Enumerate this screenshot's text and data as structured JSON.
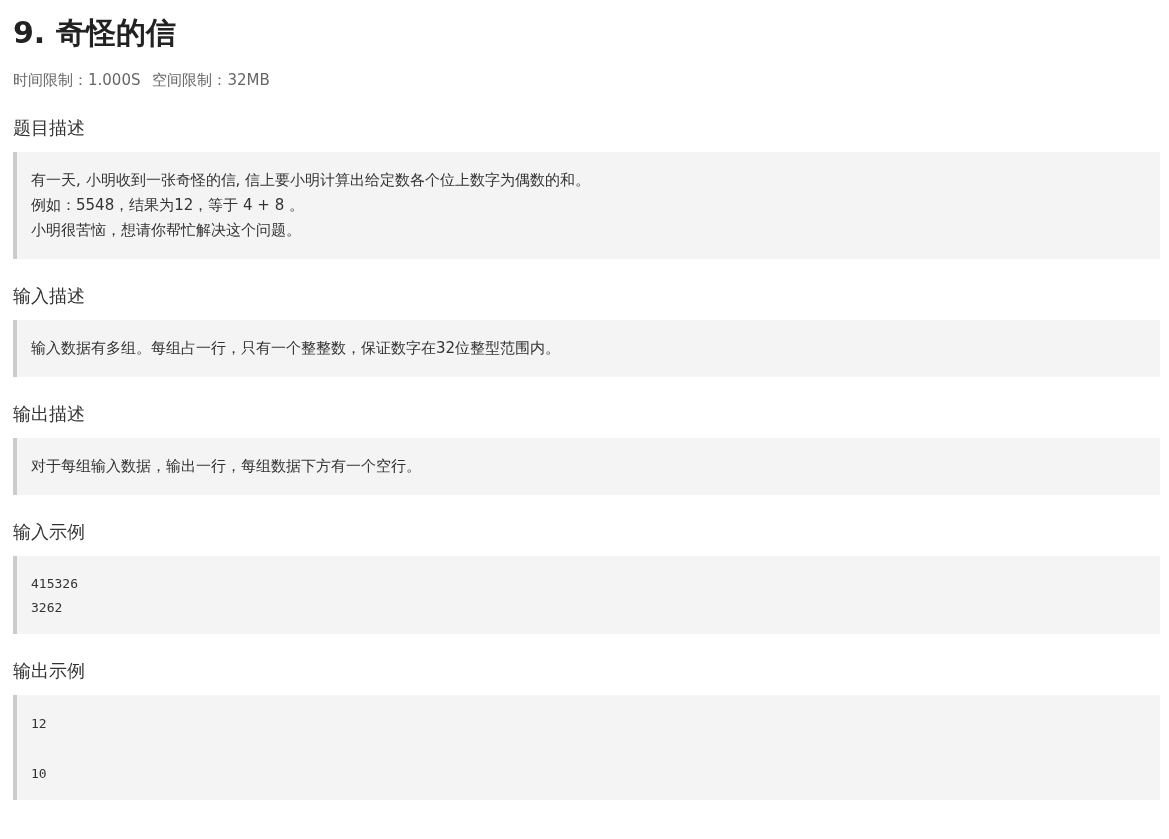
{
  "title": "9. 奇怪的信",
  "limits": [
    "时间限制：1.000S",
    "空间限制：32MB"
  ],
  "sections": [
    {
      "heading": "题目描述",
      "kind": "text",
      "lines": [
        "有一天, 小明收到一张奇怪的信, 信上要小明计算出给定数各个位上数字为偶数的和。",
        "例如：5548，结果为12，等于 4 + 8 。",
        "小明很苦恼，想请你帮忙解决这个问题。"
      ]
    },
    {
      "heading": "输入描述",
      "kind": "text",
      "lines": [
        "输入数据有多组。每组占一行，只有一个整整数，保证数字在32位整型范围内。"
      ]
    },
    {
      "heading": "输出描述",
      "kind": "text",
      "lines": [
        "对于每组输入数据，输出一行，每组数据下方有一个空行。"
      ]
    },
    {
      "heading": "输入示例",
      "kind": "code",
      "code": "415326\n3262"
    },
    {
      "heading": "输出示例",
      "kind": "code",
      "code": "12\n\n10"
    }
  ]
}
